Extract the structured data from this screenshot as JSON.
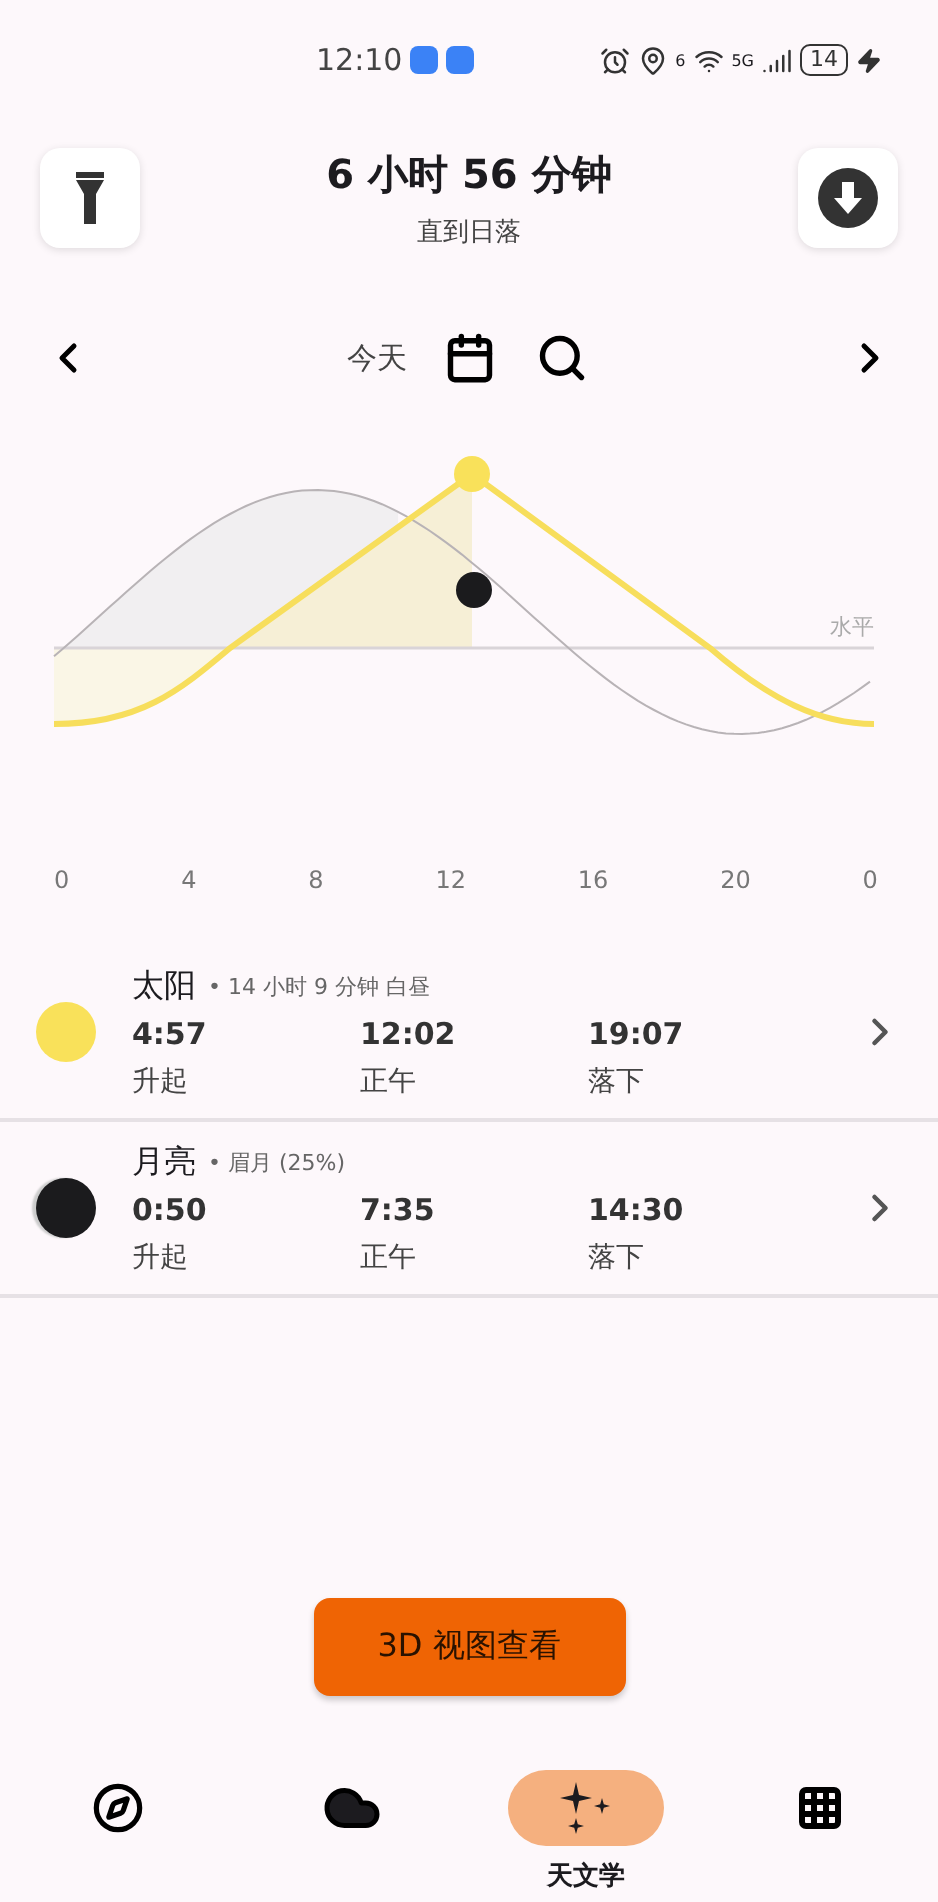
{
  "status_bar": {
    "time": "12:10",
    "wifi_badge": "6",
    "network": "5G",
    "battery": "14"
  },
  "header": {
    "title": "6 小时 56 分钟",
    "subtitle": "直到日落"
  },
  "date_nav": {
    "label": "今天"
  },
  "chart": {
    "horizon_label": "水平",
    "x_ticks": [
      "0",
      "4",
      "8",
      "12",
      "16",
      "20",
      "0"
    ]
  },
  "bodies": [
    {
      "kind": "sun",
      "name": "太阳",
      "detail": "• 14 小时 9 分钟 白昼",
      "events": [
        {
          "time": "4:57",
          "label": "升起"
        },
        {
          "time": "12:02",
          "label": "正午"
        },
        {
          "time": "19:07",
          "label": "落下"
        }
      ]
    },
    {
      "kind": "moon",
      "name": "月亮",
      "detail": "• 眉月 (25%)",
      "events": [
        {
          "time": "0:50",
          "label": "升起"
        },
        {
          "time": "7:35",
          "label": "正午"
        },
        {
          "time": "14:30",
          "label": "落下"
        }
      ]
    }
  ],
  "action_button": "3D 视图查看",
  "bottom_nav": [
    {
      "selected": false
    },
    {
      "selected": false
    },
    {
      "label": "天文学",
      "selected": true
    },
    {
      "selected": false
    }
  ]
}
